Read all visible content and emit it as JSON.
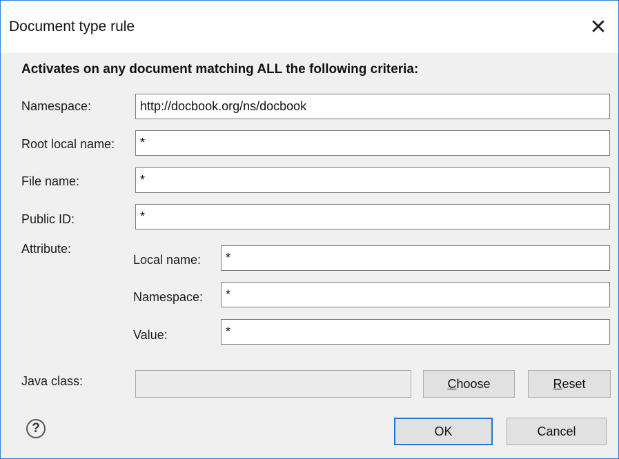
{
  "window": {
    "title": "Document type rule"
  },
  "heading": "Activates on any document matching ALL the following criteria:",
  "fields": {
    "namespace": {
      "label": "Namespace:",
      "value": "http://docbook.org/ns/docbook"
    },
    "root_local_name": {
      "label": "Root local name:",
      "value": "*"
    },
    "file_name": {
      "label": "File name:",
      "value": "*"
    },
    "public_id": {
      "label": "Public ID:",
      "value": "*"
    }
  },
  "attribute": {
    "label": "Attribute:",
    "local_name": {
      "label": "Local name:",
      "value": "*"
    },
    "namespace": {
      "label": "Namespace:",
      "value": "*"
    },
    "value": {
      "label": "Value:",
      "value": "*"
    }
  },
  "java_class": {
    "label": "Java class:",
    "value": ""
  },
  "buttons": {
    "choose_first": "C",
    "choose_rest": "hoose",
    "reset_first": "R",
    "reset_rest": "eset",
    "ok": "OK",
    "cancel": "Cancel"
  },
  "icons": {
    "close": "close-icon",
    "help": "help-icon"
  }
}
